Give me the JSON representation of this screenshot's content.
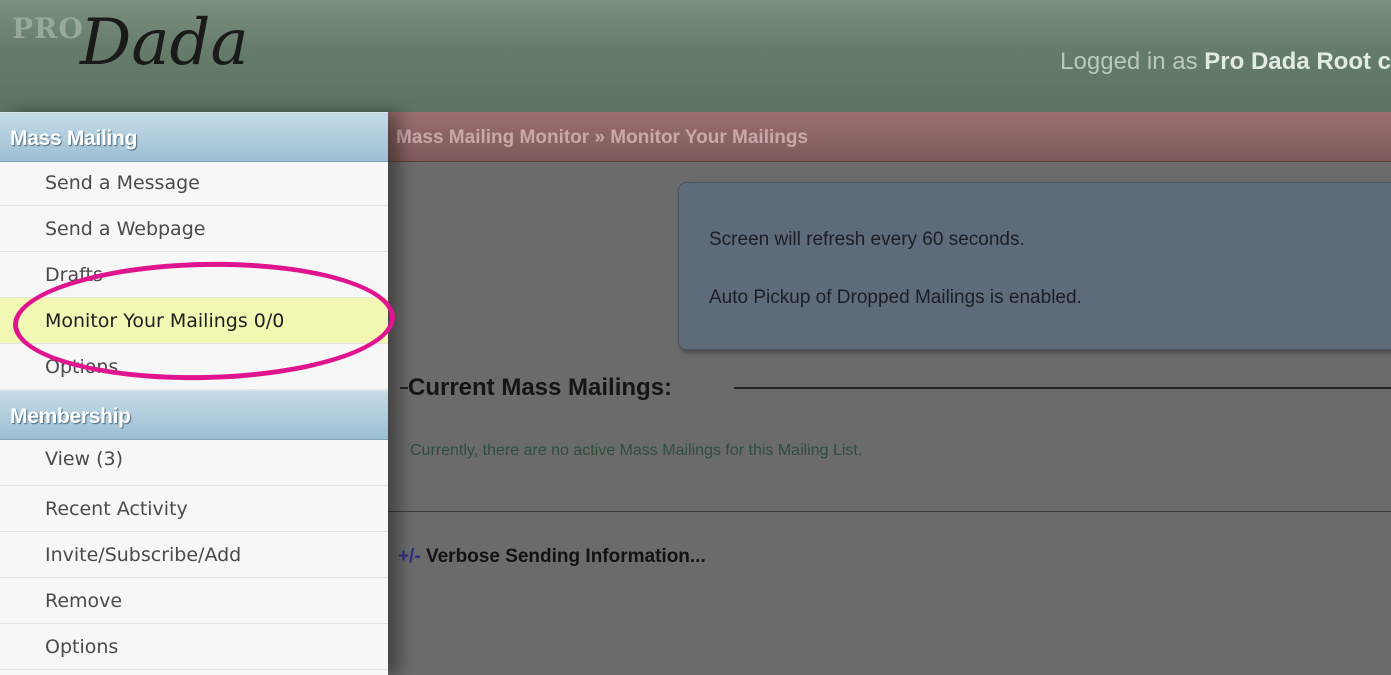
{
  "header": {
    "logo_pro": "PRO",
    "logo_dada": "Dada",
    "logged_prefix": "Logged in as",
    "logged_user": "Pro Dada Root c"
  },
  "sidebar": {
    "mass_mailing": {
      "title": "Mass Mailing",
      "items": [
        "Send a Message",
        "Send a Webpage",
        "Drafts",
        "Monitor Your Mailings 0/0",
        "Options"
      ]
    },
    "membership": {
      "title": "Membership",
      "items": [
        "View (3)",
        "Recent Activity",
        "Invite/Subscribe/Add",
        "Remove",
        "Options"
      ]
    }
  },
  "main": {
    "breadcrumb": "Mass Mailing Monitor » Monitor Your Mailings",
    "notice_refresh": "Screen will refresh every 60 seconds.",
    "notice_pickup": "Auto Pickup of Dropped Mailings is enabled.",
    "current_heading": "Current Mass Mailings:",
    "empty_message": "Currently, there are no active Mass Mailings for this Mailing List.",
    "verbose_toggle": "+/-",
    "verbose_label": "Verbose Sending Information..."
  },
  "colors": {
    "highlight_ring": "#e0148e",
    "active_item_bg": "#f2f7b4",
    "section_header": "#9cbfd3",
    "breadcrumb_bar": "#7f5a5a"
  }
}
